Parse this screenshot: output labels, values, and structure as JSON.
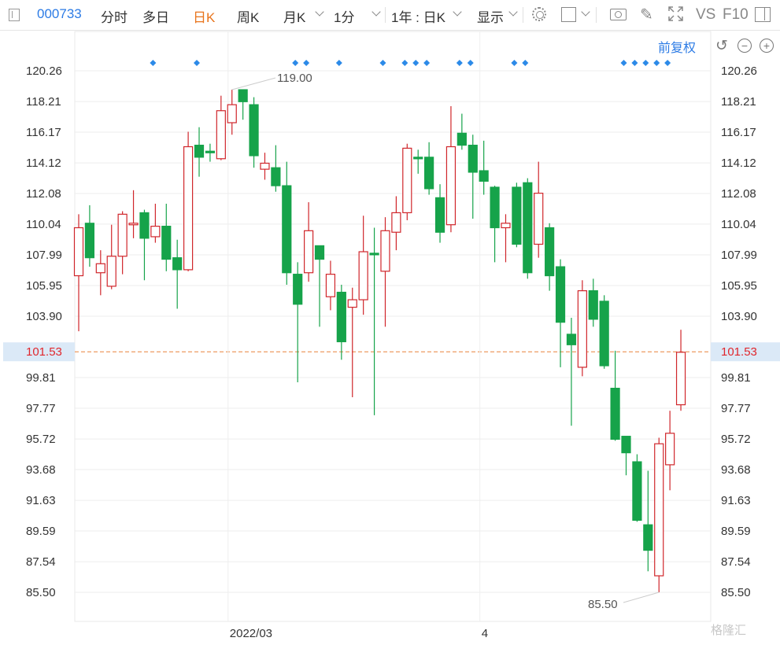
{
  "toolbar": {
    "code": "000733",
    "tabs": [
      "分时",
      "多日",
      "日K",
      "周K",
      "月K",
      "1分"
    ],
    "active_tab": "日K",
    "range": "1年 : 日K",
    "display": "显示",
    "vs": "VS",
    "f10": "F10"
  },
  "adjust": "前复权",
  "zoom_minus": "−",
  "zoom_plus": "+",
  "watermark": "格隆汇",
  "colors": {
    "up": "#d0262b",
    "down": "#16a34a",
    "marker": "#2c8ae8",
    "price_line": "#e8823a",
    "price_label_bg": "#dbe9f7"
  },
  "chart_data": {
    "type": "candlestick",
    "y_ticks": [
      "120.26",
      "118.21",
      "116.17",
      "114.12",
      "112.08",
      "110.04",
      "107.99",
      "105.95",
      "103.90",
      "101.53",
      "99.81",
      "97.77",
      "95.72",
      "93.68",
      "91.63",
      "89.59",
      "87.54",
      "85.50"
    ],
    "ylim": [
      85.5,
      120.26
    ],
    "current_price": "101.53",
    "x_labels": [
      "2022/03",
      "4"
    ],
    "high_annotation": "119.00",
    "low_annotation": "85.50",
    "candles": [
      {
        "o": 106.6,
        "c": 109.8,
        "h": 110.7,
        "l": 102.9
      },
      {
        "o": 110.1,
        "c": 107.8,
        "h": 111.3,
        "l": 107.2
      },
      {
        "o": 106.8,
        "c": 107.4,
        "h": 108.3,
        "l": 105.3
      },
      {
        "o": 105.9,
        "c": 107.9,
        "h": 110.0,
        "l": 105.7
      },
      {
        "o": 107.9,
        "c": 110.7,
        "h": 110.9,
        "l": 106.7
      },
      {
        "o": 110.0,
        "c": 110.1,
        "h": 112.3,
        "l": 109.1
      },
      {
        "o": 110.8,
        "c": 109.1,
        "h": 111.0,
        "l": 106.3
      },
      {
        "o": 109.2,
        "c": 109.9,
        "h": 111.4,
        "l": 108.8
      },
      {
        "o": 109.9,
        "c": 107.7,
        "h": 111.4,
        "l": 106.9
      },
      {
        "o": 107.8,
        "c": 107.0,
        "h": 109.0,
        "l": 104.4
      },
      {
        "o": 107.0,
        "c": 115.2,
        "h": 116.2,
        "l": 106.9
      },
      {
        "o": 115.3,
        "c": 114.5,
        "h": 116.5,
        "l": 113.2
      },
      {
        "o": 114.9,
        "c": 114.8,
        "h": 115.4,
        "l": 114.2
      },
      {
        "o": 114.4,
        "c": 117.6,
        "h": 118.6,
        "l": 114.3
      },
      {
        "o": 116.8,
        "c": 118.0,
        "h": 119.0,
        "l": 116.0
      },
      {
        "o": 119.0,
        "c": 118.2,
        "h": 119.0,
        "l": 117.0
      },
      {
        "o": 118.0,
        "c": 114.6,
        "h": 118.5,
        "l": 113.8
      },
      {
        "o": 113.7,
        "c": 114.1,
        "h": 114.8,
        "l": 113.0
      },
      {
        "o": 113.8,
        "c": 112.6,
        "h": 115.3,
        "l": 112.2
      },
      {
        "o": 112.6,
        "c": 106.8,
        "h": 114.2,
        "l": 106.0
      },
      {
        "o": 106.7,
        "c": 104.7,
        "h": 107.5,
        "l": 99.5
      },
      {
        "o": 106.8,
        "c": 109.6,
        "h": 111.5,
        "l": 106.2
      },
      {
        "o": 108.6,
        "c": 107.7,
        "h": 108.6,
        "l": 103.2
      },
      {
        "o": 105.2,
        "c": 106.7,
        "h": 107.6,
        "l": 104.3
      },
      {
        "o": 105.5,
        "c": 102.2,
        "h": 106.0,
        "l": 101.0
      },
      {
        "o": 104.5,
        "c": 105.0,
        "h": 105.8,
        "l": 98.5
      },
      {
        "o": 105.0,
        "c": 108.2,
        "h": 110.6,
        "l": 104.0
      },
      {
        "o": 108.1,
        "c": 108.0,
        "h": 109.8,
        "l": 97.3
      },
      {
        "o": 106.9,
        "c": 109.6,
        "h": 110.5,
        "l": 103.2
      },
      {
        "o": 109.5,
        "c": 110.8,
        "h": 111.9,
        "l": 108.3
      },
      {
        "o": 110.8,
        "c": 115.1,
        "h": 115.4,
        "l": 110.3
      },
      {
        "o": 114.5,
        "c": 114.4,
        "h": 115.0,
        "l": 113.4
      },
      {
        "o": 114.5,
        "c": 112.4,
        "h": 115.5,
        "l": 112.0
      },
      {
        "o": 111.8,
        "c": 109.5,
        "h": 112.7,
        "l": 108.8
      },
      {
        "o": 110.0,
        "c": 115.2,
        "h": 117.9,
        "l": 109.5
      },
      {
        "o": 116.1,
        "c": 115.3,
        "h": 117.4,
        "l": 115.0
      },
      {
        "o": 115.3,
        "c": 113.5,
        "h": 116.0,
        "l": 110.4
      },
      {
        "o": 113.6,
        "c": 112.9,
        "h": 115.6,
        "l": 112.0
      },
      {
        "o": 112.5,
        "c": 109.8,
        "h": 112.6,
        "l": 107.5
      },
      {
        "o": 109.8,
        "c": 110.1,
        "h": 110.7,
        "l": 107.5
      },
      {
        "o": 112.5,
        "c": 108.7,
        "h": 112.8,
        "l": 108.5
      },
      {
        "o": 112.8,
        "c": 106.8,
        "h": 113.1,
        "l": 106.4
      },
      {
        "o": 108.7,
        "c": 112.1,
        "h": 114.2,
        "l": 107.8
      },
      {
        "o": 109.8,
        "c": 106.6,
        "h": 110.1,
        "l": 105.6
      },
      {
        "o": 107.2,
        "c": 103.5,
        "h": 107.7,
        "l": 100.5
      },
      {
        "o": 102.7,
        "c": 102.0,
        "h": 103.8,
        "l": 96.6
      },
      {
        "o": 100.5,
        "c": 105.6,
        "h": 106.3,
        "l": 99.9
      },
      {
        "o": 105.6,
        "c": 103.7,
        "h": 106.4,
        "l": 103.2
      },
      {
        "o": 104.9,
        "c": 100.6,
        "h": 105.3,
        "l": 100.4
      },
      {
        "o": 99.1,
        "c": 95.7,
        "h": 101.6,
        "l": 95.6
      },
      {
        "o": 95.9,
        "c": 94.8,
        "h": 95.9,
        "l": 93.3
      },
      {
        "o": 94.2,
        "c": 90.3,
        "h": 94.7,
        "l": 90.2
      },
      {
        "o": 90.0,
        "c": 88.3,
        "h": 93.6,
        "l": 86.9
      },
      {
        "o": 86.6,
        "c": 95.4,
        "h": 95.8,
        "l": 85.5
      },
      {
        "o": 94.0,
        "c": 96.1,
        "h": 97.6,
        "l": 92.3
      },
      {
        "o": 98.0,
        "c": 101.5,
        "h": 103.0,
        "l": 97.6
      }
    ],
    "event_marker_candles": [
      7,
      11,
      20,
      21,
      24,
      28,
      30,
      31,
      32,
      35,
      36,
      40,
      41,
      50,
      51,
      52,
      53,
      54
    ]
  }
}
